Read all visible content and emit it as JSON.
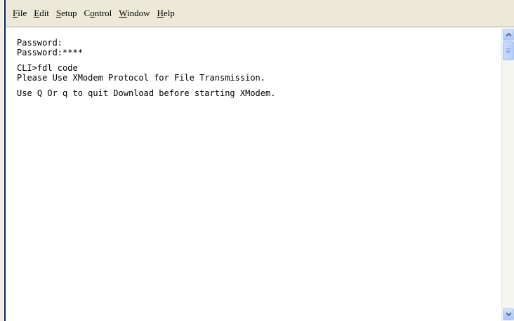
{
  "menu": [
    {
      "acc": "F",
      "rest": "ile"
    },
    {
      "acc": "E",
      "rest": "dit"
    },
    {
      "acc": "S",
      "rest": "etup"
    },
    {
      "pre": "C",
      "acc": "o",
      "rest": "ntrol"
    },
    {
      "acc": "W",
      "rest": "indow"
    },
    {
      "acc": "H",
      "rest": "elp"
    }
  ],
  "terminal": {
    "lines": [
      "Password:",
      "Password:****",
      "CLI>fdl code",
      "Please Use XModem Protocol for File Transmission.",
      "Use Q Or q to quit Download before starting XModem."
    ]
  },
  "icons": {
    "scroll_up": "chevron-up-icon",
    "scroll_down": "chevron-down-icon"
  }
}
